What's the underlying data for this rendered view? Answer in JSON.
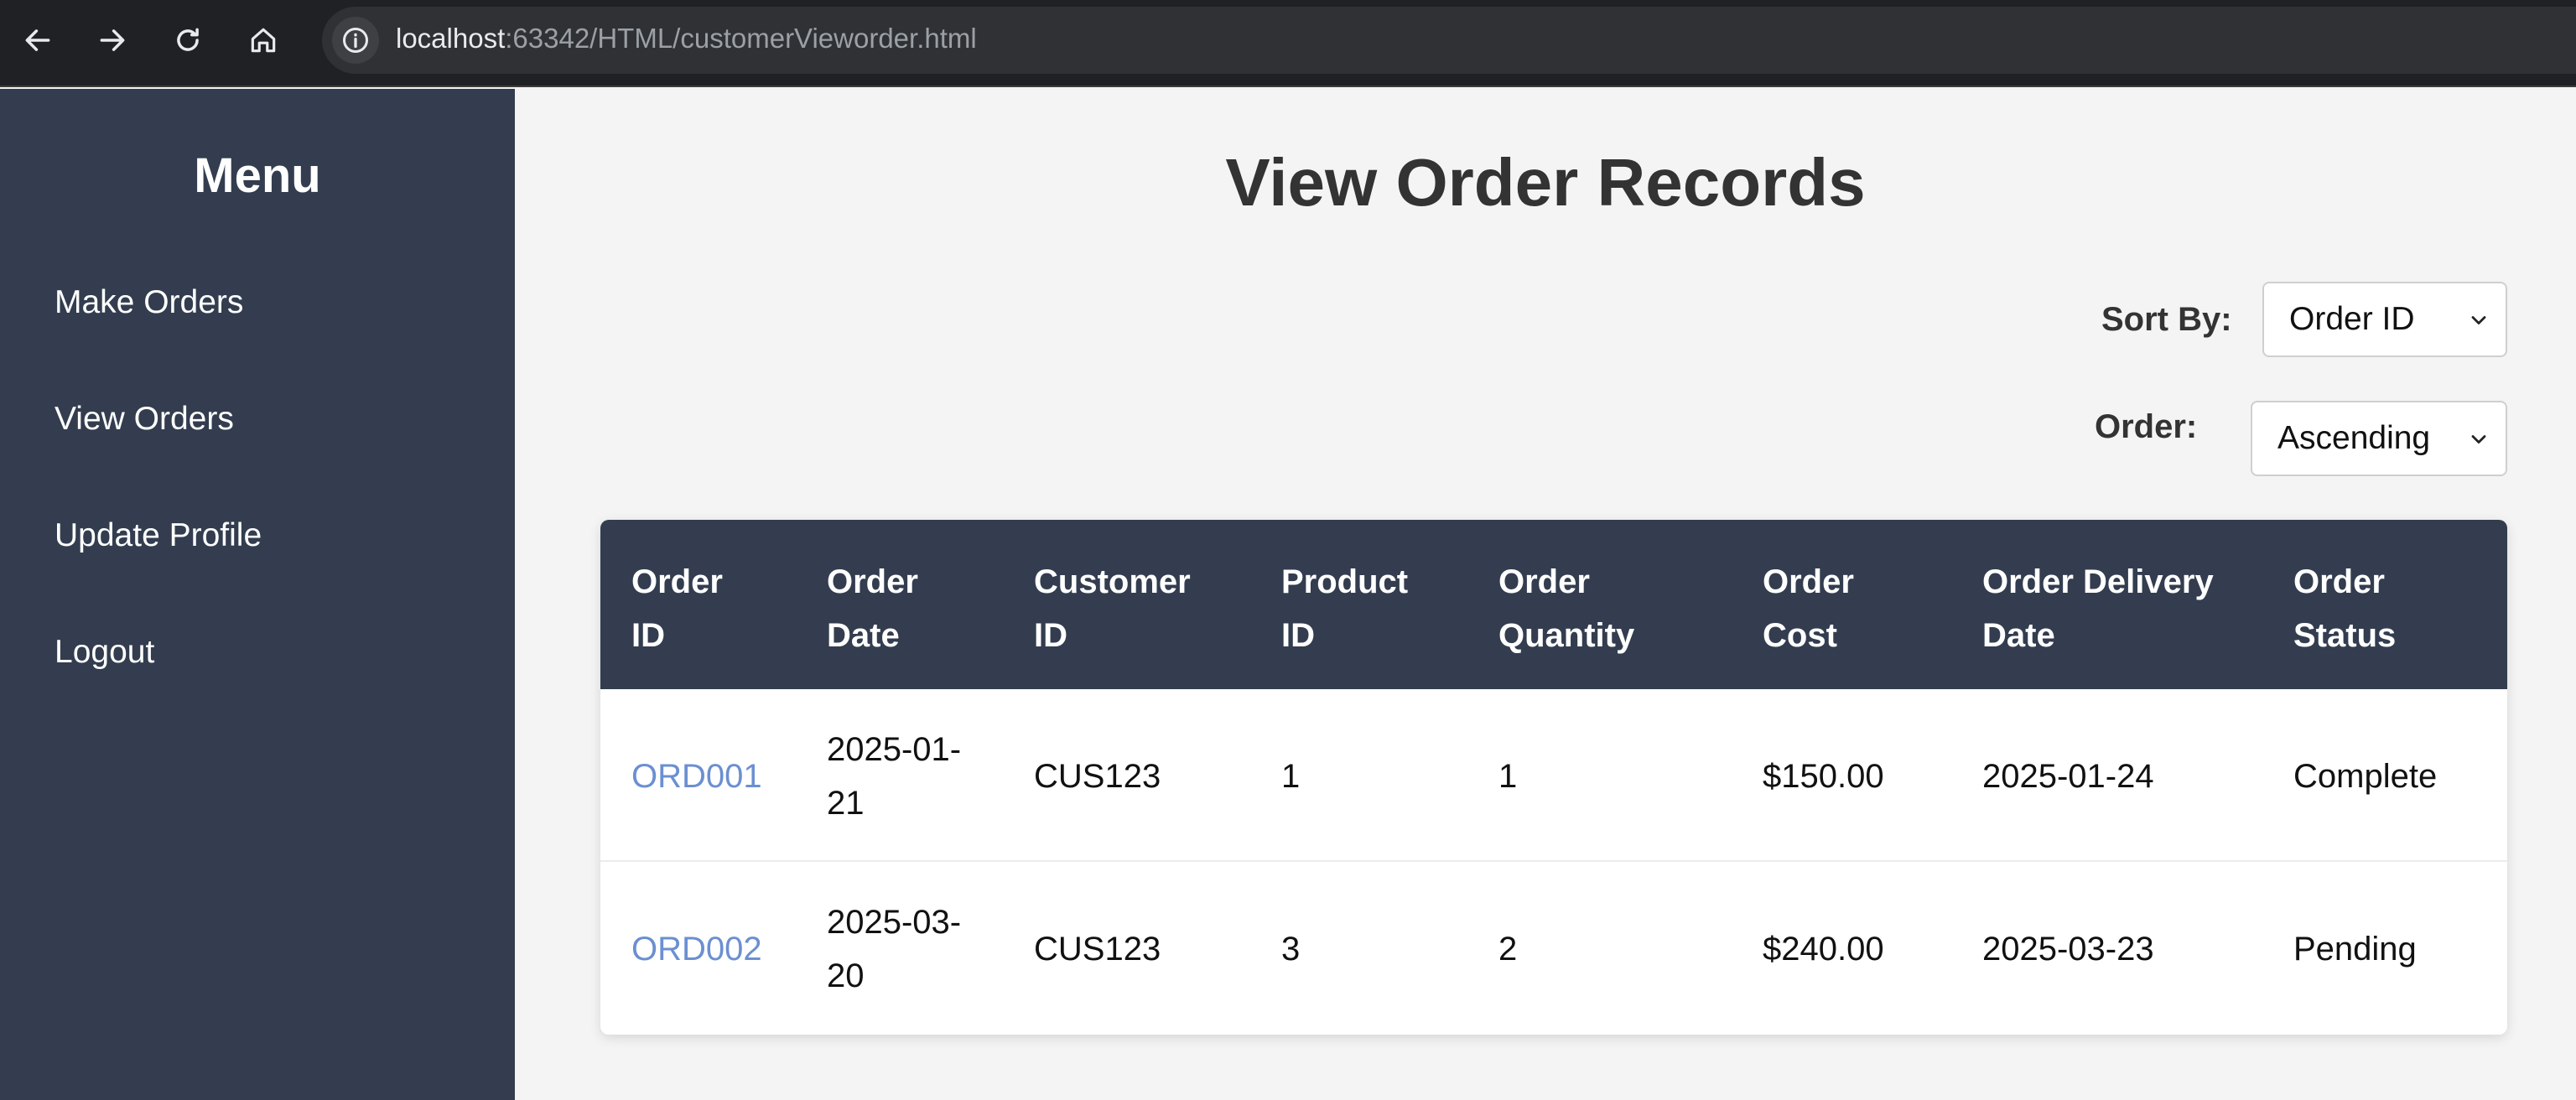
{
  "browser": {
    "url_host": "localhost",
    "url_rest": ":63342/HTML/customerVieworder.html"
  },
  "sidebar": {
    "title": "Menu",
    "items": [
      {
        "label": "Make Orders"
      },
      {
        "label": "View Orders"
      },
      {
        "label": "Update Profile"
      },
      {
        "label": "Logout"
      }
    ]
  },
  "main": {
    "title": "View Order Records",
    "sort_by_label": "Sort By:",
    "sort_by_value": "Order ID",
    "order_label": "Order:",
    "order_value": "Ascending"
  },
  "table": {
    "headers": [
      [
        "Order",
        "ID"
      ],
      [
        "Order",
        "Date"
      ],
      [
        "Customer",
        "ID"
      ],
      [
        "Product",
        "ID"
      ],
      [
        "Order",
        "Quantity"
      ],
      [
        "Order",
        "Cost"
      ],
      [
        "Order Delivery",
        "Date"
      ],
      [
        "Order",
        "Status"
      ]
    ],
    "rows": [
      {
        "order_id": "ORD001",
        "order_date": [
          "2025-01-",
          "21"
        ],
        "customer_id": "CUS123",
        "product_id": "1",
        "quantity": "1",
        "cost": "$150.00",
        "delivery_date": "2025-01-24",
        "status": "Complete"
      },
      {
        "order_id": "ORD002",
        "order_date": [
          "2025-03-",
          "20"
        ],
        "customer_id": "CUS123",
        "product_id": "3",
        "quantity": "2",
        "cost": "$240.00",
        "delivery_date": "2025-03-23",
        "status": "Pending"
      }
    ]
  },
  "colors": {
    "sidebar_bg": "#333d4f",
    "link": "#6b8fd1",
    "page_bg": "#f4f4f4"
  }
}
